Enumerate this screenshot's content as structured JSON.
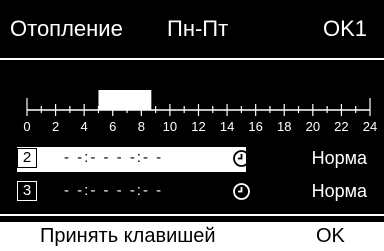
{
  "header": {
    "title": "Отопление",
    "days": "Пн-Пт",
    "circuit": "OK1"
  },
  "timeline": {
    "ticks": [
      "0",
      "2",
      "4",
      "6",
      "8",
      "10",
      "12",
      "14",
      "16",
      "18",
      "20",
      "22",
      "24"
    ],
    "active_block": {
      "start_hour": 5.0,
      "end_hour": 8.7
    }
  },
  "rows": [
    {
      "number": "2",
      "times": "- -:- -  - -:- -",
      "icon": "clock-icon",
      "mode": "Норма",
      "selected": true
    },
    {
      "number": "3",
      "times": "- -:- -  - -:- -",
      "icon": "clock-icon",
      "mode": "Норма",
      "selected": false
    }
  ],
  "footer": {
    "accept_label": "Принять клавишей",
    "ok_label": "OK"
  },
  "colors": {
    "background": "#000000",
    "foreground": "#ffffff"
  }
}
